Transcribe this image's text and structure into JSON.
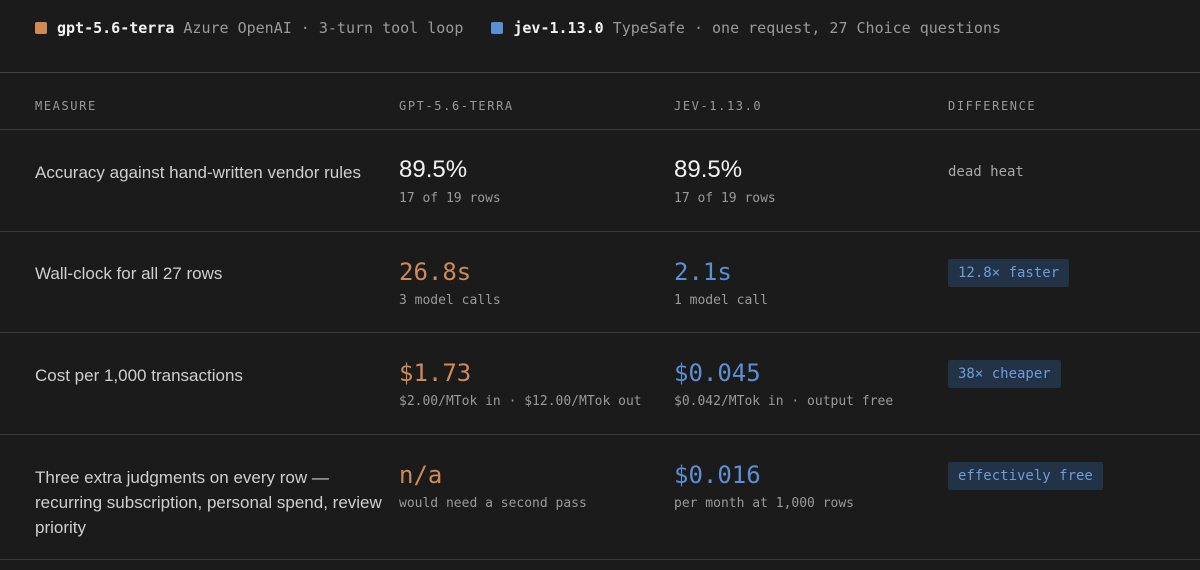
{
  "colors": {
    "terra": "#d08a58",
    "jev": "#5b8fd6",
    "neutral": "#f2f2f2"
  },
  "legend": [
    {
      "name": "gpt-5.6-terra",
      "desc": "Azure OpenAI · 3-turn tool loop",
      "color": "#d08a58"
    },
    {
      "name": "jev-1.13.0",
      "desc": "TypeSafe · one request, 27 Choice questions",
      "color": "#5b8fd6"
    }
  ],
  "table": {
    "headers": {
      "measure": "MEASURE",
      "a": "GPT-5.6-TERRA",
      "b": "JEV-1.13.0",
      "diff": "DIFFERENCE"
    },
    "rows": [
      {
        "measure": "Accuracy against hand-written vendor rules",
        "a_value": "89.5%",
        "a_sub": "17 of 19 rows",
        "a_tone": "neutral",
        "b_value": "89.5%",
        "b_sub": "17 of 19 rows",
        "b_tone": "neutral",
        "diff": "dead heat",
        "diff_style": "plain"
      },
      {
        "measure": "Wall-clock for all 27 rows",
        "a_value": "26.8s",
        "a_sub": "3 model calls",
        "a_tone": "terra",
        "b_value": "2.1s",
        "b_sub": "1 model call",
        "b_tone": "jev",
        "diff": "12.8× faster",
        "diff_style": "badge"
      },
      {
        "measure": "Cost per 1,000 transactions",
        "a_value": "$1.73",
        "a_sub": "$2.00/MTok in · $12.00/MTok out",
        "a_tone": "terra",
        "b_value": "$0.045",
        "b_sub": "$0.042/MTok in · output free",
        "b_tone": "jev",
        "diff": "38× cheaper",
        "diff_style": "badge"
      },
      {
        "measure": "Three extra judgments on every row — recurring subscription, personal spend, review priority",
        "a_value": "n/a",
        "a_sub": "would need a second pass",
        "a_tone": "terra",
        "b_value": "$0.016",
        "b_sub": "per month at 1,000 rows",
        "b_tone": "jev",
        "diff": "effectively free",
        "diff_style": "badge"
      }
    ]
  }
}
